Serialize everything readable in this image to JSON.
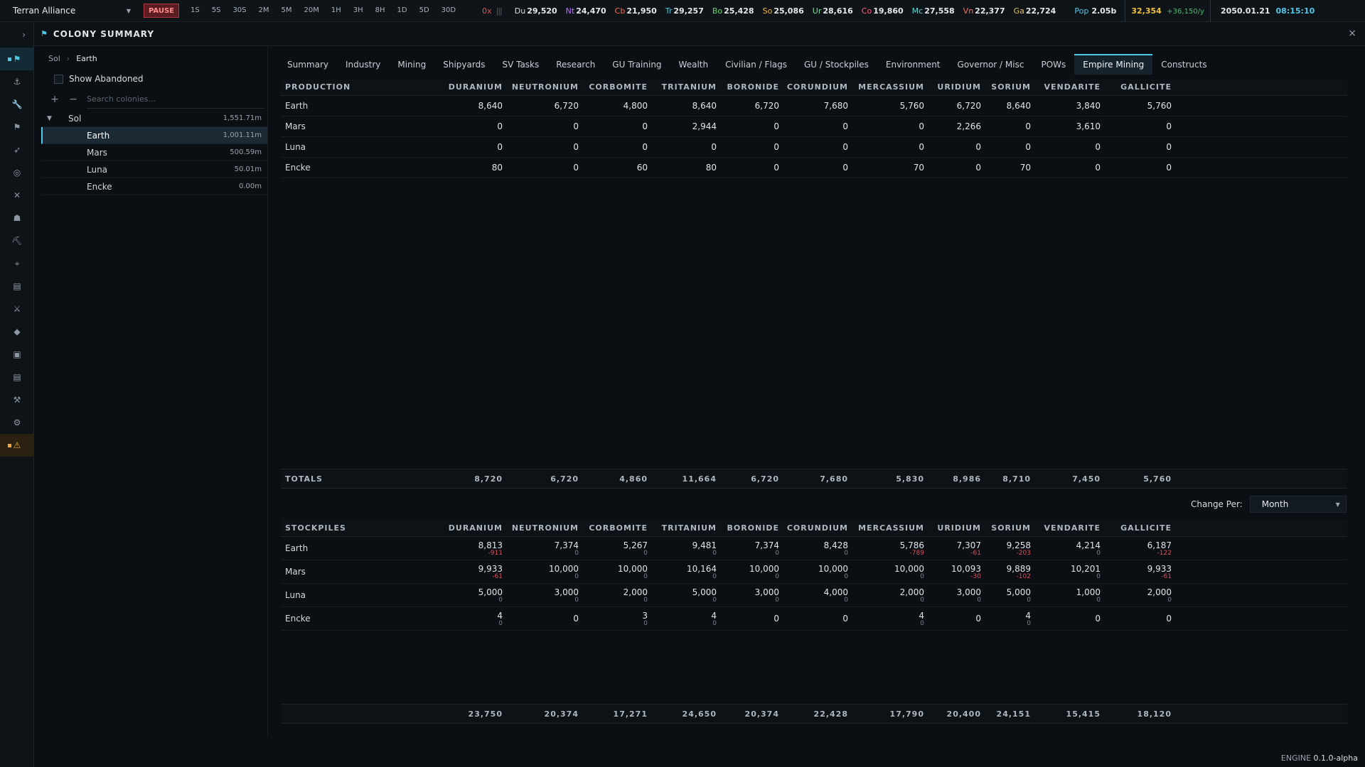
{
  "topbar": {
    "empire_name": "Terran Alliance",
    "pause_label": "PAUSE",
    "speeds": [
      "1S",
      "5S",
      "30S",
      "2M",
      "5M",
      "20M",
      "1H",
      "3H",
      "8H",
      "1D",
      "5D",
      "30D"
    ],
    "speed_multiplier": "0x",
    "resources": [
      {
        "abbr": "Du",
        "value": "29,520",
        "color": "#d8e0e8"
      },
      {
        "abbr": "Nt",
        "value": "24,470",
        "color": "#c070ff"
      },
      {
        "abbr": "Cb",
        "value": "21,950",
        "color": "#ff6a4a"
      },
      {
        "abbr": "Tr",
        "value": "29,257",
        "color": "#4fc7e8"
      },
      {
        "abbr": "Bo",
        "value": "25,428",
        "color": "#6ad86a"
      },
      {
        "abbr": "So",
        "value": "25,086",
        "color": "#f0b83a"
      },
      {
        "abbr": "Ur",
        "value": "28,616",
        "color": "#7ee0a0"
      },
      {
        "abbr": "Co",
        "value": "19,860",
        "color": "#ff5a78"
      },
      {
        "abbr": "Mc",
        "value": "27,558",
        "color": "#5ad8d0"
      },
      {
        "abbr": "Vn",
        "value": "22,377",
        "color": "#ff7060"
      },
      {
        "abbr": "Ga",
        "value": "22,724",
        "color": "#e0c060"
      }
    ],
    "population_label": "Pop",
    "population_value": "2.05b",
    "wealth_value": "32,354",
    "wealth_rate": "+36,150/y",
    "date": "2050.01.21",
    "time": "08:15:10"
  },
  "rail_icons": [
    "chevron-right-icon",
    "flag-icon",
    "anchor-icon",
    "wrench-icon",
    "flag-small-icon",
    "rocket-icon",
    "target-icon",
    "swords-icon",
    "person-icon",
    "pickaxe-icon",
    "telescope-icon",
    "clipboard-icon",
    "crossed-swords-icon",
    "tag-icon",
    "box-icon",
    "document-icon",
    "tool-icon",
    "gear-icon",
    "warning-icon"
  ],
  "panel": {
    "title": "COLONY SUMMARY",
    "close": "×"
  },
  "tree": {
    "breadcrumb": [
      "Sol",
      "Earth"
    ],
    "show_abandoned": "Show Abandoned",
    "add": "+",
    "remove": "−",
    "search_placeholder": "Search colonies...",
    "system": {
      "name": "Sol",
      "value": "1,551.71m"
    },
    "bodies": [
      {
        "name": "Earth",
        "value": "1,001.11m",
        "selected": true
      },
      {
        "name": "Mars",
        "value": "500.59m"
      },
      {
        "name": "Luna",
        "value": "50.01m"
      },
      {
        "name": "Encke",
        "value": "0.00m"
      }
    ]
  },
  "tabs": [
    "Summary",
    "Industry",
    "Mining",
    "Shipyards",
    "SV Tasks",
    "Research",
    "GU Training",
    "Wealth",
    "Civilian / Flags",
    "GU / Stockpiles",
    "Environment",
    "Governor / Misc",
    "POWs",
    "Empire Mining",
    "Constructs"
  ],
  "active_tab": "Empire Mining",
  "minerals": [
    "DURANIUM",
    "NEUTRONIUM",
    "CORBOMITE",
    "TRITANIUM",
    "BORONIDE",
    "CORUNDIUM",
    "MERCASSIUM",
    "URIDIUM",
    "SORIUM",
    "VENDARITE",
    "GALLICITE"
  ],
  "production": {
    "header": "PRODUCTION",
    "rows": [
      {
        "name": "Earth",
        "values": [
          "8,640",
          "6,720",
          "4,800",
          "8,640",
          "6,720",
          "7,680",
          "5,760",
          "6,720",
          "8,640",
          "3,840",
          "5,760"
        ]
      },
      {
        "name": "Mars",
        "values": [
          "0",
          "0",
          "0",
          "2,944",
          "0",
          "0",
          "0",
          "2,266",
          "0",
          "3,610",
          "0"
        ]
      },
      {
        "name": "Luna",
        "values": [
          "0",
          "0",
          "0",
          "0",
          "0",
          "0",
          "0",
          "0",
          "0",
          "0",
          "0"
        ]
      },
      {
        "name": "Encke",
        "values": [
          "80",
          "0",
          "60",
          "80",
          "0",
          "0",
          "70",
          "0",
          "70",
          "0",
          "0"
        ]
      }
    ],
    "totals_label": "TOTALS",
    "totals": [
      "8,720",
      "6,720",
      "4,860",
      "11,664",
      "6,720",
      "7,680",
      "5,830",
      "8,986",
      "8,710",
      "7,450",
      "5,760"
    ]
  },
  "change_per": {
    "label": "Change Per:",
    "value": "Month"
  },
  "stockpiles": {
    "header": "STOCKPILES",
    "rows": [
      {
        "name": "Earth",
        "values": [
          "8,813",
          "7,374",
          "5,267",
          "9,481",
          "7,374",
          "8,428",
          "5,786",
          "7,307",
          "9,258",
          "4,214",
          "6,187"
        ],
        "deltas": [
          "-911",
          "0",
          "0",
          "0",
          "0",
          "0",
          "-789",
          "-61",
          "-203",
          "0",
          "-122"
        ]
      },
      {
        "name": "Mars",
        "values": [
          "9,933",
          "10,000",
          "10,000",
          "10,164",
          "10,000",
          "10,000",
          "10,000",
          "10,093",
          "9,889",
          "10,201",
          "9,933"
        ],
        "deltas": [
          "-61",
          "0",
          "0",
          "0",
          "0",
          "0",
          "0",
          "-30",
          "-102",
          "0",
          "-61"
        ]
      },
      {
        "name": "Luna",
        "values": [
          "5,000",
          "3,000",
          "2,000",
          "5,000",
          "3,000",
          "4,000",
          "2,000",
          "3,000",
          "5,000",
          "1,000",
          "2,000"
        ],
        "deltas": [
          "0",
          "0",
          "0",
          "0",
          "0",
          "0",
          "0",
          "0",
          "0",
          "0",
          "0"
        ]
      },
      {
        "name": "Encke",
        "values": [
          "4",
          "0",
          "3",
          "4",
          "0",
          "0",
          "4",
          "0",
          "4",
          "0",
          "0"
        ],
        "deltas": [
          "0",
          "",
          "0",
          "0",
          "",
          "",
          "0",
          "",
          "0",
          "",
          ""
        ]
      }
    ],
    "totals": [
      "23,750",
      "20,374",
      "17,271",
      "24,650",
      "20,374",
      "22,428",
      "17,790",
      "20,400",
      "24,151",
      "15,415",
      "18,120"
    ]
  },
  "footer": {
    "label": "ENGINE",
    "version": "0.1.0-alpha"
  }
}
